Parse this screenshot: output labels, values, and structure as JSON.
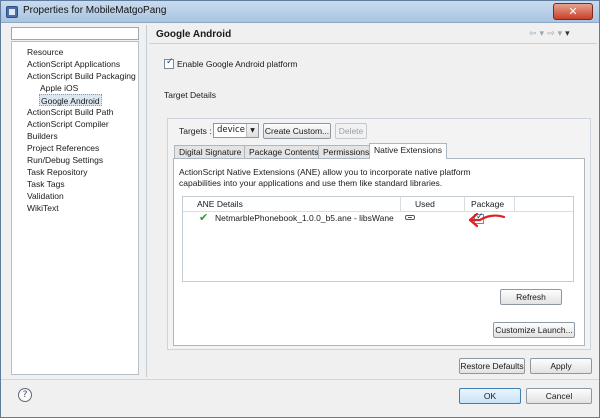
{
  "window": {
    "title": "Properties for MobileMatgoPang"
  },
  "nav": {
    "items": [
      {
        "label": "Resource",
        "indent": 0
      },
      {
        "label": "ActionScript Applications",
        "indent": 0
      },
      {
        "label": "ActionScript Build Packaging",
        "indent": 0
      },
      {
        "label": "Apple iOS",
        "indent": 1
      },
      {
        "label": "Google Android",
        "indent": 1,
        "selected": true
      },
      {
        "label": "ActionScript Build Path",
        "indent": 0
      },
      {
        "label": "ActionScript Compiler",
        "indent": 0
      },
      {
        "label": "Builders",
        "indent": 0
      },
      {
        "label": "Project References",
        "indent": 0
      },
      {
        "label": "Run/Debug Settings",
        "indent": 0
      },
      {
        "label": "Task Repository",
        "indent": 0
      },
      {
        "label": "Task Tags",
        "indent": 0
      },
      {
        "label": "Validation",
        "indent": 0
      },
      {
        "label": "WikiText",
        "indent": 0
      }
    ]
  },
  "page": {
    "title": "Google Android",
    "enable_label": "Enable Google Android platform",
    "enable_checked": true,
    "target_details_label": "Target Details",
    "targets_label": "Targets :",
    "targets_value": "device",
    "create_custom_label": "Create Custom...",
    "delete_label": "Delete",
    "tabs": [
      "Digital Signature",
      "Package Contents",
      "Permissions",
      "Native Extensions"
    ],
    "active_tab": "Native Extensions",
    "ane_description": "ActionScript Native Extensions (ANE) allow you to incorporate native platform capabilities into your applications and use them like standard libraries.",
    "table": {
      "columns": [
        "ANE Details",
        "Used",
        "Package"
      ],
      "rows": [
        {
          "name": "NetmarblePhonebook_1.0.0_b5.ane - libsWane",
          "package_checked": true
        }
      ]
    },
    "refresh_label": "Refresh",
    "customize_launch_label": "Customize Launch...",
    "restore_defaults_label": "Restore Defaults",
    "apply_label": "Apply"
  },
  "footer": {
    "ok_label": "OK",
    "cancel_label": "Cancel"
  },
  "colors": {
    "accent": "#3c7fb1",
    "annotation_arrow": "#e02020",
    "check_green": "#2e9a2e"
  },
  "icons": {
    "help": "help-icon",
    "close": "close-icon",
    "check": "check-icon",
    "used": "used-icon"
  }
}
